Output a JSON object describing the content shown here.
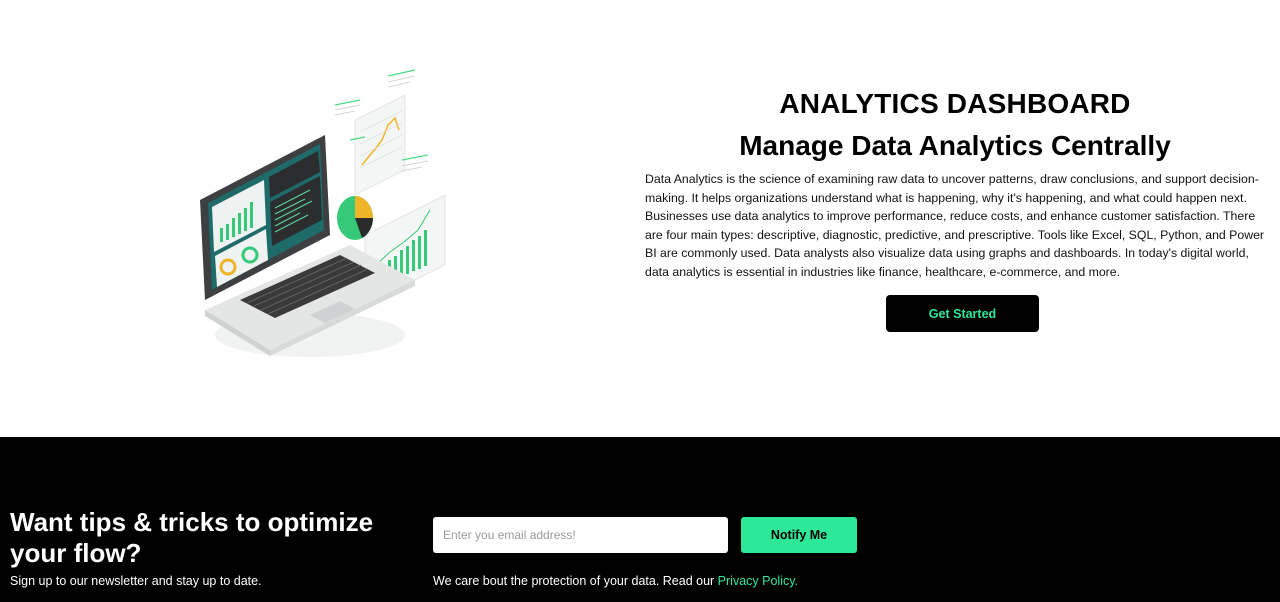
{
  "hero": {
    "title": "ANALYTICS DASHBOARD",
    "subtitle": "Manage Data Analytics Centrally",
    "description": "Data Analytics is the science of examining raw data to uncover patterns, draw conclusions, and support decision-making. It helps organizations understand what is happening, why it's happening, and what could happen next. Businesses use data analytics to improve performance, reduce costs, and enhance customer satisfaction. There are four main types: descriptive, diagnostic, predictive, and prescriptive. Tools like Excel, SQL, Python, and Power BI are commonly used. Data analysts also visualize data using graphs and dashboards. In today's digital world, data analytics is essential in industries like finance, healthcare, e-commerce, and more.",
    "cta_label": "Get Started",
    "illustration_icon": "laptop-analytics-illustration"
  },
  "newsletter": {
    "title": "Want tips & tricks to optimize your flow?",
    "subtitle": "Sign up to our newsletter and stay up to date.",
    "email_placeholder": "Enter you email address!",
    "email_value": "",
    "button_label": "Notify Me",
    "privacy_text": "We care bout the protection of your data. Read our ",
    "privacy_link": "Privacy Policy."
  },
  "colors": {
    "accent": "#2ee89a",
    "footer_bg": "#000000",
    "hero_bg": "#ffffff"
  }
}
